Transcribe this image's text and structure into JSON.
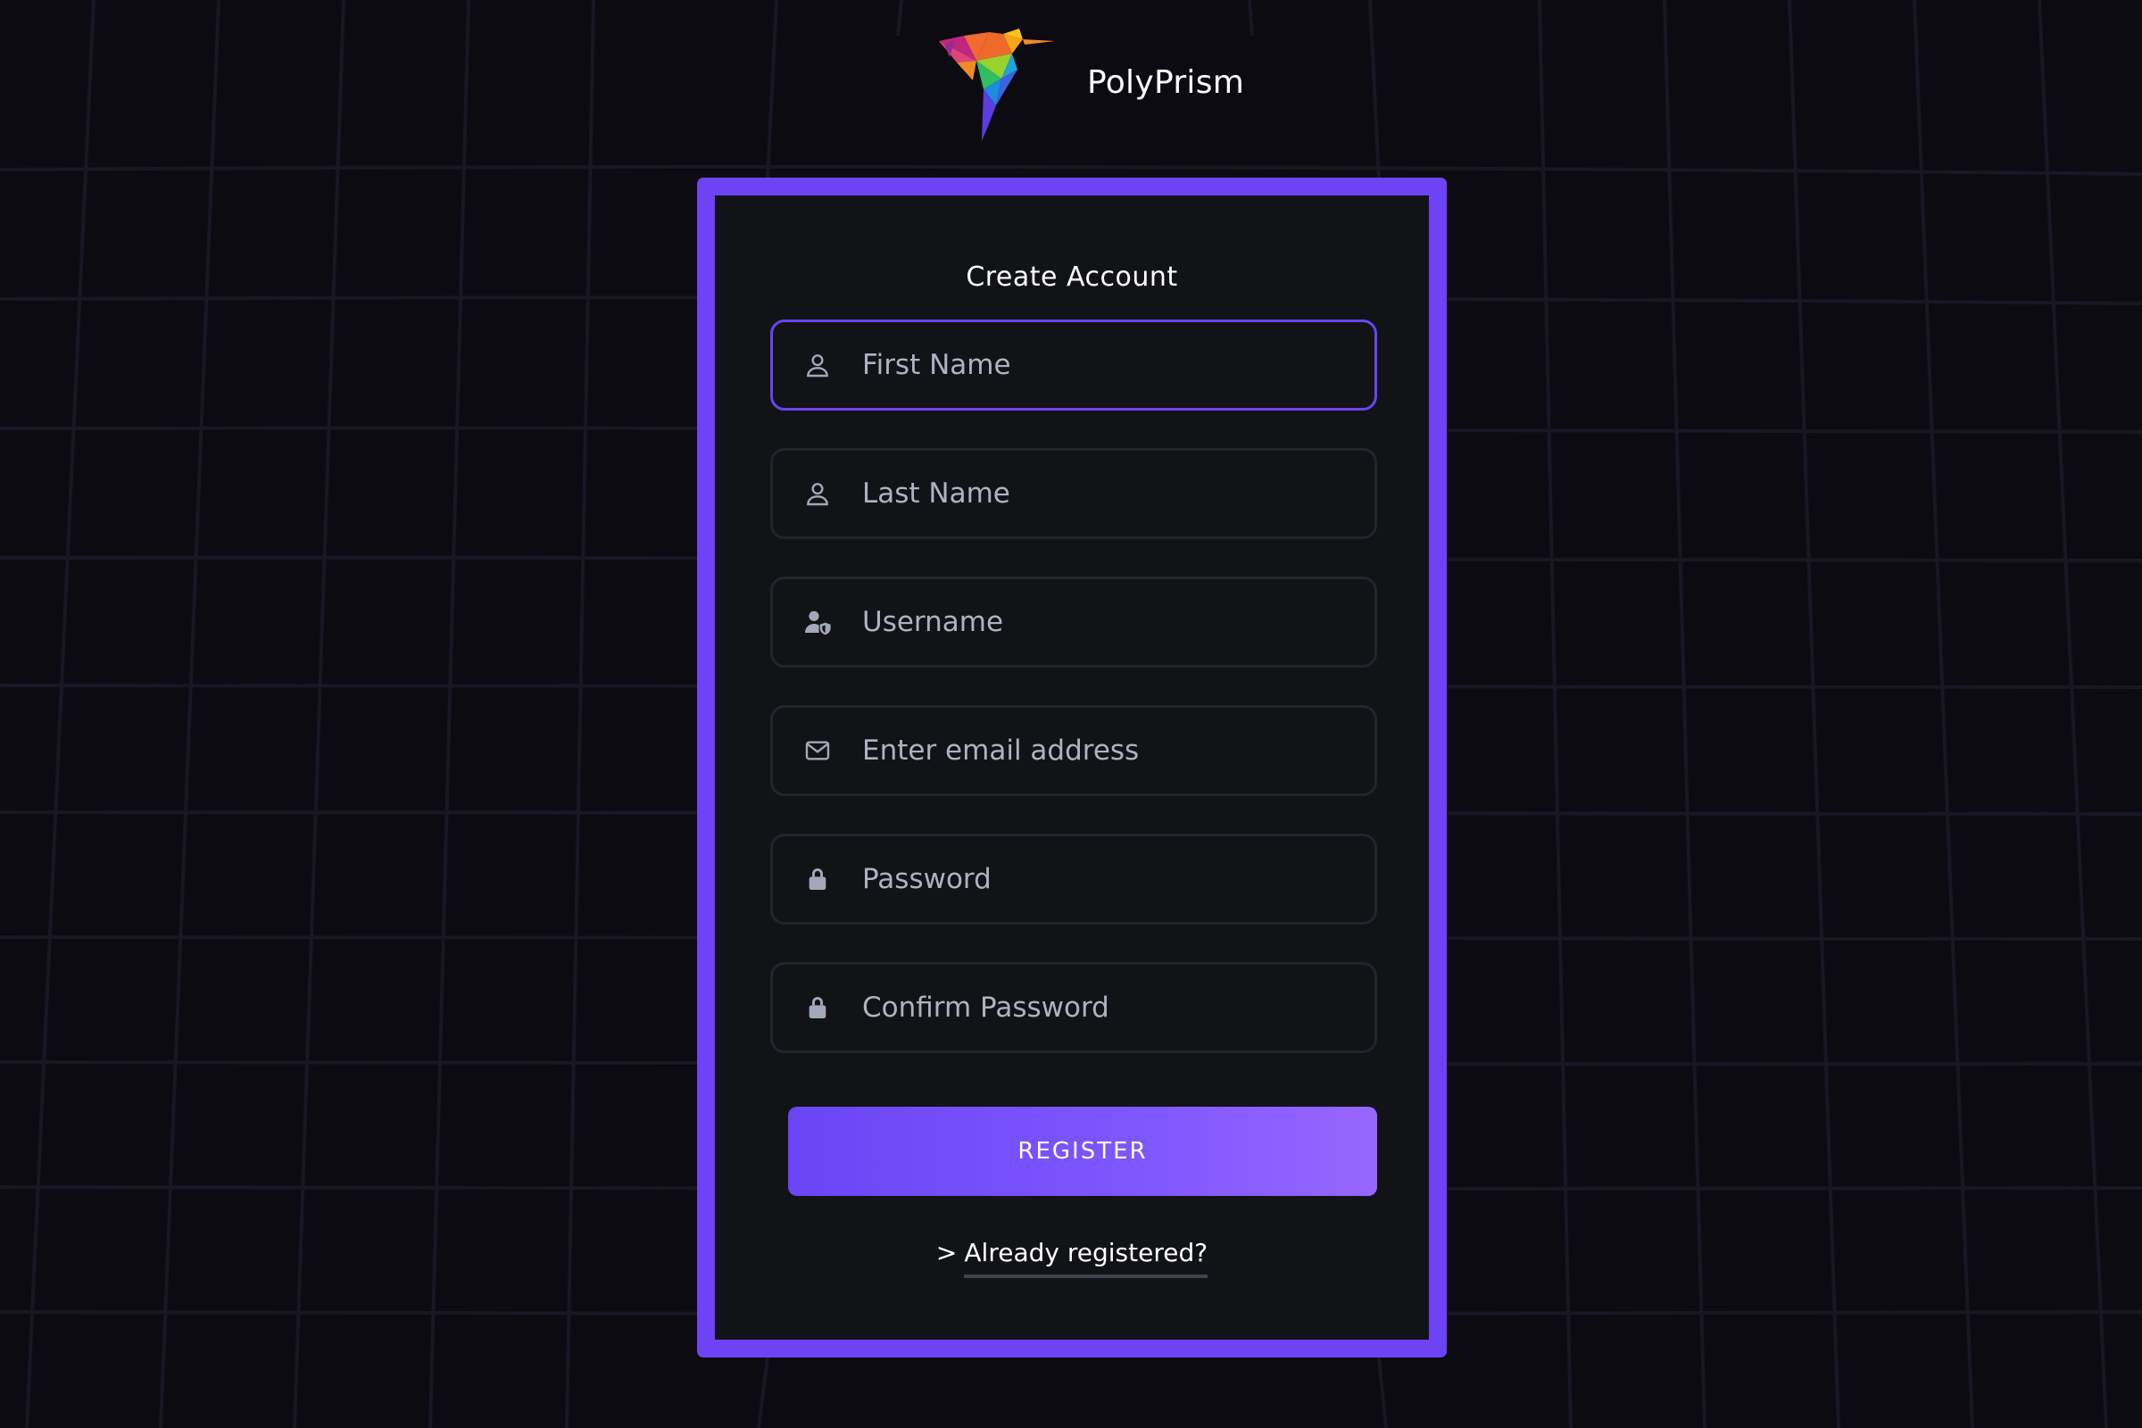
{
  "brand": {
    "name": "PolyPrism",
    "logo_icon": "polygon-hummingbird-logo"
  },
  "form": {
    "title": "Create Account",
    "fields": [
      {
        "placeholder": "First Name",
        "value": "",
        "icon": "user-outline-icon",
        "focused": true
      },
      {
        "placeholder": "Last Name",
        "value": "",
        "icon": "user-outline-icon",
        "focused": false
      },
      {
        "placeholder": "Username",
        "value": "",
        "icon": "user-shield-icon",
        "focused": false
      },
      {
        "placeholder": "Enter email address",
        "value": "",
        "icon": "envelope-icon",
        "focused": false
      },
      {
        "placeholder": "Password",
        "value": "",
        "icon": "lock-icon",
        "focused": false
      },
      {
        "placeholder": "Confirm Password",
        "value": "",
        "icon": "lock-icon",
        "focused": false
      }
    ],
    "register_label": "REGISTER",
    "login_arrow": ">",
    "login_link_label": "Already registered?"
  },
  "colors": {
    "background": "#0c0b12",
    "grid_line": "#1a1624",
    "card_frame": "#6d43f5",
    "card": "#121317",
    "field_border": "#23252b",
    "field_focus_border": "#6a44f2",
    "icon": "#a3a8b8",
    "placeholder": "#aeb3c2",
    "button_gradient_start": "#6a45f4",
    "button_gradient_end": "#9866ff"
  }
}
